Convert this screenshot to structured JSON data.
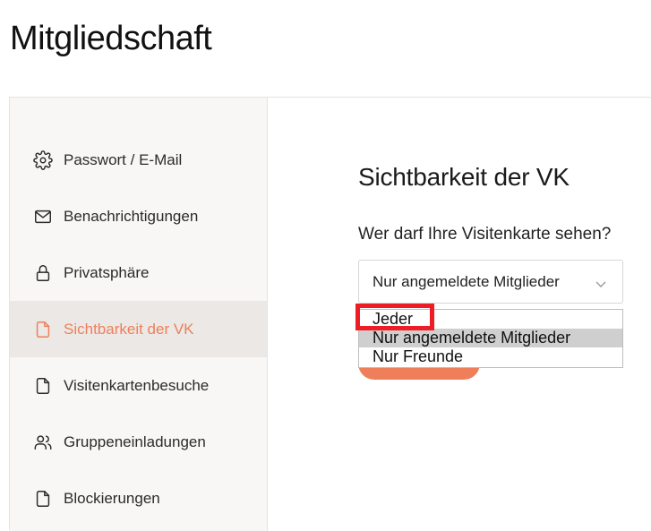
{
  "page": {
    "title": "Mitgliedschaft"
  },
  "sidebar": {
    "items": [
      {
        "label": "Passwort / E-Mail",
        "icon": "gear-icon"
      },
      {
        "label": "Benachrichtigungen",
        "icon": "mail-icon"
      },
      {
        "label": "Privatsphäre",
        "icon": "lock-icon"
      },
      {
        "label": "Sichtbarkeit der VK",
        "icon": "document-icon",
        "active": true
      },
      {
        "label": "Visitenkartenbesuche",
        "icon": "document-icon"
      },
      {
        "label": "Gruppeneinladungen",
        "icon": "users-icon"
      },
      {
        "label": "Blockierungen",
        "icon": "document-icon"
      }
    ]
  },
  "main": {
    "section_title": "Sichtbarkeit der VK",
    "question": "Wer darf Ihre Visitenkarte sehen?",
    "select": {
      "value": "Nur angemeldete Mitglieder",
      "options": [
        "Jeder",
        "Nur angemeldete Mitglieder",
        "Nur Freunde"
      ],
      "highlighted_option": "Nur angemeldete Mitglieder",
      "marked_option": "Jeder"
    }
  },
  "colors": {
    "accent": "#ef7f5a",
    "active_item_bg": "#ebe8e6",
    "sidebar_bg": "#f9f7f5",
    "marker": "#ee1c25"
  }
}
